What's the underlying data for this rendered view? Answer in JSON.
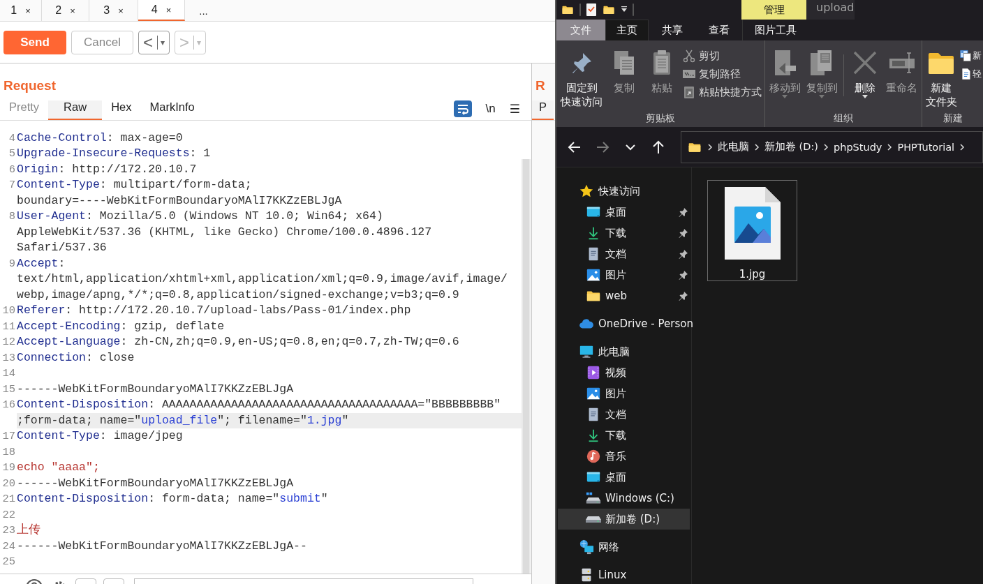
{
  "burp": {
    "tabs": [
      {
        "label": "1",
        "close": "×",
        "selected": false
      },
      {
        "label": "2",
        "close": "×",
        "selected": false
      },
      {
        "label": "3",
        "close": "×",
        "selected": false
      },
      {
        "label": "4",
        "close": "×",
        "selected": true
      }
    ],
    "more_tab": "...",
    "toolbar": {
      "send": "Send",
      "cancel": "Cancel",
      "history": [
        {
          "arrow": "<",
          "caret": "▾",
          "disabled": false
        },
        {
          "arrow": ">",
          "caret": "▾",
          "disabled": true
        }
      ]
    },
    "request": {
      "title": "Request",
      "tabs": [
        {
          "label": "Pretty",
          "selected": false,
          "disabled": true
        },
        {
          "label": "Raw",
          "selected": true,
          "disabled": false
        },
        {
          "label": "Hex",
          "selected": false,
          "disabled": false
        },
        {
          "label": "MarkInfo",
          "selected": false,
          "disabled": false
        }
      ],
      "wrap_on": true,
      "newline_toggle": "\\n",
      "menu": "☰",
      "rows": [
        {
          "number": "4",
          "highlighted": false,
          "segments": [
            {
              "kind": "name",
              "text": "Cache-Control"
            },
            {
              "kind": "plain",
              "text": ": max-age=0"
            }
          ]
        },
        {
          "number": "5",
          "highlighted": false,
          "segments": [
            {
              "kind": "name",
              "text": "Upgrade-Insecure-Requests"
            },
            {
              "kind": "plain",
              "text": ": 1"
            }
          ]
        },
        {
          "number": "6",
          "highlighted": false,
          "segments": [
            {
              "kind": "name",
              "text": "Origin"
            },
            {
              "kind": "plain",
              "text": ": http://172.20.10.7"
            }
          ]
        },
        {
          "number": "7",
          "highlighted": false,
          "segments": [
            {
              "kind": "name",
              "text": "Content-Type"
            },
            {
              "kind": "plain",
              "text": ": multipart/form-data;"
            }
          ]
        },
        {
          "highlighted": false,
          "segments": [
            {
              "kind": "plain",
              "text": "boundary=----WebKitFormBoundaryoMAlI7KKZzEBLJgA"
            }
          ]
        },
        {
          "number": "8",
          "highlighted": false,
          "segments": [
            {
              "kind": "name",
              "text": "User-Agent"
            },
            {
              "kind": "plain",
              "text": ": Mozilla/5.0 (Windows NT 10.0; Win64; x64)"
            }
          ]
        },
        {
          "highlighted": false,
          "segments": [
            {
              "kind": "plain",
              "text": "AppleWebKit/537.36 (KHTML, like Gecko) Chrome/100.0.4896.127"
            }
          ]
        },
        {
          "highlighted": false,
          "segments": [
            {
              "kind": "plain",
              "text": "Safari/537.36"
            }
          ]
        },
        {
          "number": "9",
          "highlighted": false,
          "segments": [
            {
              "kind": "name",
              "text": "Accept"
            },
            {
              "kind": "plain",
              "text": ":"
            }
          ]
        },
        {
          "highlighted": false,
          "segments": [
            {
              "kind": "plain",
              "text": "text/html,application/xhtml+xml,application/xml;q=0.9,image/avif,image/"
            }
          ]
        },
        {
          "highlighted": false,
          "segments": [
            {
              "kind": "plain",
              "text": "webp,image/apng,*/*;q=0.8,application/signed-exchange;v=b3;q=0.9"
            }
          ]
        },
        {
          "number": "10",
          "highlighted": false,
          "segments": [
            {
              "kind": "name",
              "text": "Referer"
            },
            {
              "kind": "plain",
              "text": ": http://172.20.10.7/upload-labs/Pass-01/index.php"
            }
          ]
        },
        {
          "number": "11",
          "highlighted": false,
          "segments": [
            {
              "kind": "name",
              "text": "Accept-Encoding"
            },
            {
              "kind": "plain",
              "text": ": gzip, deflate"
            }
          ]
        },
        {
          "number": "12",
          "highlighted": false,
          "segments": [
            {
              "kind": "name",
              "text": "Accept-Language"
            },
            {
              "kind": "plain",
              "text": ": zh-CN,zh;q=0.9,en-US;q=0.8,en;q=0.7,zh-TW;q=0.6"
            }
          ]
        },
        {
          "number": "13",
          "highlighted": false,
          "segments": [
            {
              "kind": "name",
              "text": "Connection"
            },
            {
              "kind": "plain",
              "text": ": close"
            }
          ]
        },
        {
          "number": "14",
          "highlighted": false,
          "segments": []
        },
        {
          "number": "15",
          "highlighted": false,
          "segments": [
            {
              "kind": "plain",
              "text": "------WebKitFormBoundaryoMAlI7KKZzEBLJgA"
            }
          ]
        },
        {
          "number": "16",
          "highlighted": false,
          "segments": [
            {
              "kind": "name",
              "text": "Content-Disposition"
            },
            {
              "kind": "plain",
              "text": ": AAAAAAAAAAAAAAAAAAAAAAAAAAAAAAAAAAAAA=\"BBBBBBBBB\""
            }
          ]
        },
        {
          "highlighted": true,
          "segments": [
            {
              "kind": "plain",
              "text": ";form-data; name=\""
            },
            {
              "kind": "string",
              "text": "upload_file"
            },
            {
              "kind": "plain",
              "text": "\"; filename=\""
            },
            {
              "kind": "string",
              "text": "1.jpg"
            },
            {
              "kind": "plain",
              "text": "\""
            }
          ]
        },
        {
          "number": "17",
          "highlighted": false,
          "segments": [
            {
              "kind": "name",
              "text": "Content-Type"
            },
            {
              "kind": "plain",
              "text": ": image/jpeg"
            }
          ]
        },
        {
          "number": "18",
          "highlighted": false,
          "segments": []
        },
        {
          "number": "19",
          "highlighted": false,
          "segments": [
            {
              "kind": "body",
              "text": "echo \"aaaa\";"
            }
          ]
        },
        {
          "number": "20",
          "highlighted": false,
          "segments": [
            {
              "kind": "plain",
              "text": "------WebKitFormBoundaryoMAlI7KKZzEBLJgA"
            }
          ]
        },
        {
          "number": "21",
          "highlighted": false,
          "segments": [
            {
              "kind": "name",
              "text": "Content-Disposition"
            },
            {
              "kind": "plain",
              "text": ": form-data; name=\""
            },
            {
              "kind": "string",
              "text": "submit"
            },
            {
              "kind": "plain",
              "text": "\""
            }
          ]
        },
        {
          "number": "22",
          "highlighted": false,
          "segments": []
        },
        {
          "number": "23",
          "highlighted": false,
          "segments": [
            {
              "kind": "body",
              "text": "上传"
            }
          ]
        },
        {
          "number": "24",
          "highlighted": false,
          "segments": [
            {
              "kind": "plain",
              "text": "------WebKitFormBoundaryoMAlI7KKZzEBLJgA--"
            }
          ]
        },
        {
          "number": "25",
          "highlighted": false,
          "segments": []
        }
      ]
    },
    "response": {
      "title": "R",
      "tabs": [
        {
          "label": "P",
          "selected": true
        }
      ]
    }
  },
  "explorer": {
    "title": "upload",
    "context_tab": "管理",
    "ribbon_tabs": [
      {
        "label": "文件",
        "kind": "file",
        "selected": false
      },
      {
        "label": "主页",
        "kind": "tab",
        "selected": true
      },
      {
        "label": "共享",
        "kind": "tab",
        "selected": false
      },
      {
        "label": "查看",
        "kind": "tab",
        "selected": false
      },
      {
        "label": "图片工具",
        "kind": "context",
        "selected": false
      }
    ],
    "ribbon_groups": [
      {
        "label": "剪贴板",
        "large": [
          {
            "kind": "pin",
            "lines": [
              "固定到",
              "快速访问"
            ],
            "disabled": false,
            "dropdown": false
          },
          {
            "kind": "copy",
            "lines": [
              "复制"
            ],
            "disabled": true,
            "dropdown": false
          },
          {
            "kind": "paste",
            "lines": [
              "粘贴"
            ],
            "disabled": true,
            "dropdown": false
          }
        ],
        "small": [
          {
            "kind": "cut",
            "label": "剪切",
            "disabled": true
          },
          {
            "kind": "copy-path",
            "label": "复制路径",
            "disabled": true
          },
          {
            "kind": "paste-shortcut",
            "label": "粘贴快捷方式",
            "disabled": true
          }
        ]
      },
      {
        "label": "组织",
        "large": [
          {
            "kind": "move-to",
            "lines": [
              "移动到"
            ],
            "disabled": true,
            "dropdown": true
          },
          {
            "kind": "copy-to",
            "lines": [
              "复制到"
            ],
            "disabled": true,
            "dropdown": true
          },
          {
            "kind": "delete",
            "lines": [
              "删除"
            ],
            "disabled": false,
            "dropdown": true
          },
          {
            "kind": "rename",
            "lines": [
              "重命名"
            ],
            "disabled": true,
            "dropdown": false
          }
        ]
      },
      {
        "label": "新建",
        "large": [
          {
            "kind": "new-folder",
            "lines": [
              "新建",
              "文件夹"
            ],
            "disabled": false,
            "dropdown": false
          }
        ],
        "small": [
          {
            "kind": "new-item",
            "label": "新",
            "disabled": false
          },
          {
            "kind": "easy-access",
            "label": "轻",
            "disabled": false
          }
        ]
      }
    ],
    "nav_buttons": [
      {
        "kind": "back",
        "disabled": false
      },
      {
        "kind": "forward",
        "disabled": true
      },
      {
        "kind": "recent",
        "disabled": false
      },
      {
        "kind": "up",
        "disabled": false
      }
    ],
    "breadcrumbs": [
      "此电脑",
      "新加卷 (D:)",
      "phpStudy",
      "PHPTutorial"
    ],
    "tree": [
      {
        "label": "快速访问",
        "kind": "star",
        "selected": false,
        "children": [
          {
            "label": "桌面",
            "kind": "desktop",
            "selected": false,
            "pinned": true
          },
          {
            "label": "下载",
            "kind": "download",
            "selected": false,
            "pinned": true
          },
          {
            "label": "文档",
            "kind": "document",
            "selected": false,
            "pinned": true
          },
          {
            "label": "图片",
            "kind": "pictures",
            "selected": false,
            "pinned": true
          },
          {
            "label": "web",
            "kind": "folder",
            "selected": false,
            "pinned": true
          }
        ]
      },
      {
        "label": "OneDrive - Person",
        "kind": "cloud",
        "selected": false
      },
      {
        "label": "此电脑",
        "kind": "computer",
        "selected": false,
        "children": [
          {
            "label": "视频",
            "kind": "video",
            "selected": false,
            "pinned": false
          },
          {
            "label": "图片",
            "kind": "pictures",
            "selected": false,
            "pinned": false
          },
          {
            "label": "文档",
            "kind": "document",
            "selected": false,
            "pinned": false
          },
          {
            "label": "下载",
            "kind": "download",
            "selected": false,
            "pinned": false
          },
          {
            "label": "音乐",
            "kind": "music",
            "selected": false,
            "pinned": false
          },
          {
            "label": "桌面",
            "kind": "desktop",
            "selected": false,
            "pinned": false
          },
          {
            "label": "Windows (C:)",
            "kind": "system-drive",
            "selected": false,
            "pinned": false
          },
          {
            "label": "新加卷 (D:)",
            "kind": "drive",
            "selected": true,
            "pinned": false
          }
        ]
      },
      {
        "label": "网络",
        "kind": "network",
        "selected": false
      },
      {
        "label": "Linux",
        "kind": "server",
        "selected": false
      }
    ],
    "files": [
      {
        "name": "1.jpg",
        "kind": "image",
        "focused": true
      }
    ]
  }
}
